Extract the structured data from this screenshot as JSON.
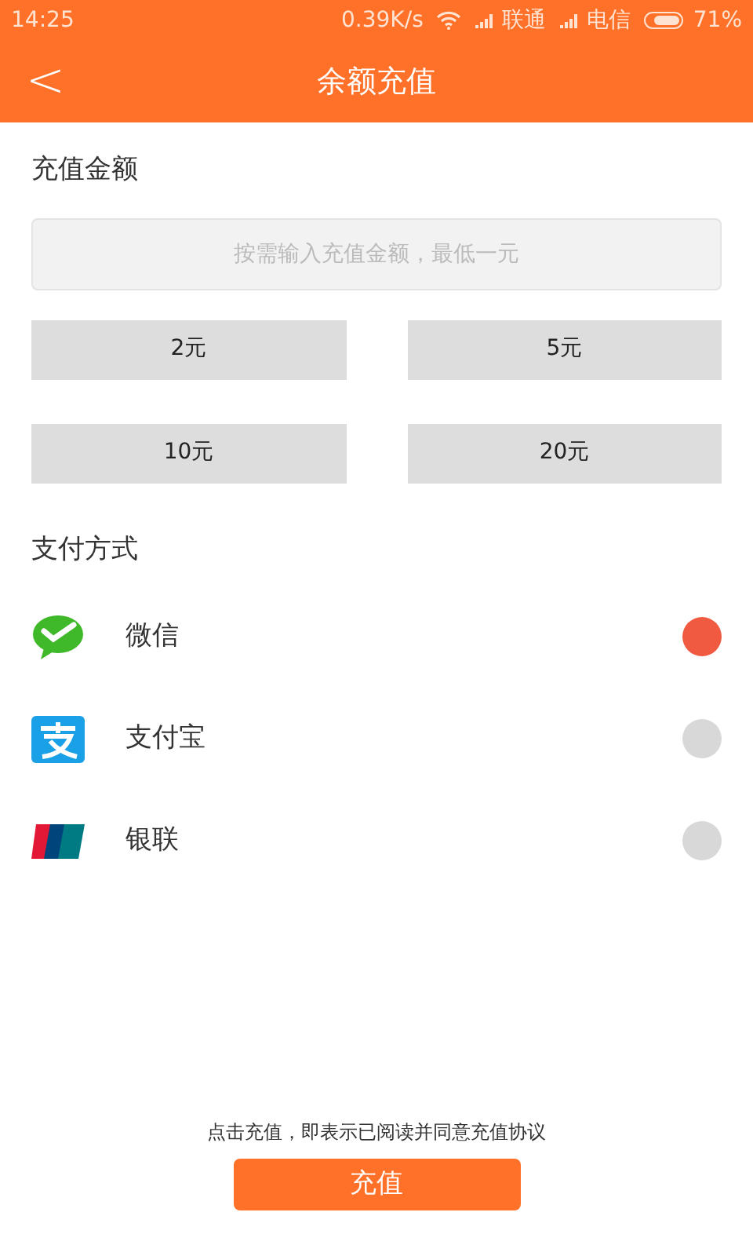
{
  "status_bar": {
    "time": "14:25",
    "speed": "0.39K/s",
    "carrier_1": "联通",
    "carrier_2": "电信",
    "battery": "71%"
  },
  "header": {
    "back": "<",
    "title": "余额充值"
  },
  "amount": {
    "label": "充值金额",
    "placeholder": "按需输入充值金额，最低一元",
    "options": [
      {
        "label": "2元"
      },
      {
        "label": "5元"
      },
      {
        "label": "10元"
      },
      {
        "label": "20元"
      }
    ]
  },
  "payment": {
    "label": "支付方式",
    "methods": [
      {
        "kind": "wechat",
        "name": "微信",
        "selected": true
      },
      {
        "kind": "alipay",
        "name": "支付宝",
        "selected": false
      },
      {
        "kind": "unionpay",
        "name": "银联",
        "selected": false
      }
    ]
  },
  "footer": {
    "agreement": "点击充值，即表示已阅读并同意充值协议",
    "submit": "充值"
  }
}
